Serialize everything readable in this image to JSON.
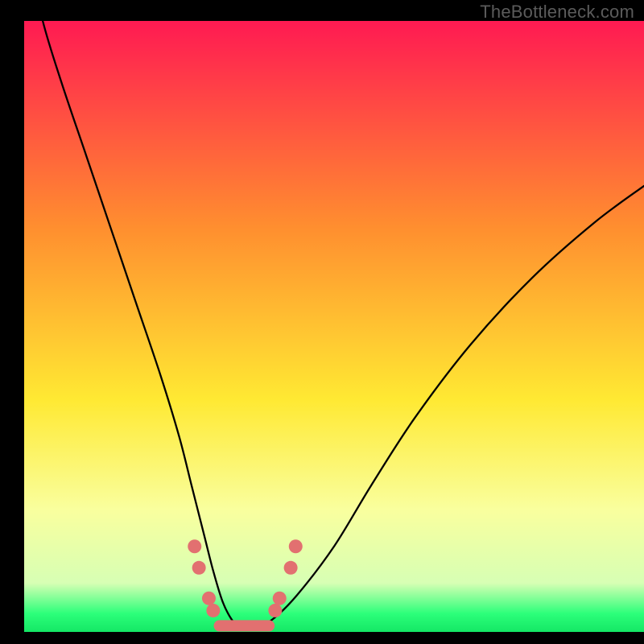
{
  "attribution": "TheBottleneck.com",
  "colors": {
    "frame": "#000000",
    "gradient_top": "#ff1a52",
    "gradient_mid_upper": "#ff8f2f",
    "gradient_mid": "#ffe933",
    "gradient_lower": "#f9ff9e",
    "gradient_green": "#2cff7a",
    "curve": "#000000",
    "marker": "#e27070"
  },
  "chart_data": {
    "type": "line",
    "title": "",
    "xlabel": "",
    "ylabel": "",
    "xlim": [
      0,
      100
    ],
    "ylim": [
      0,
      100
    ],
    "grid": false,
    "legend": false,
    "annotations": [],
    "series": [
      {
        "name": "bottleneck-curve",
        "x": [
          3,
          6,
          10,
          14,
          18,
          22,
          25,
          27,
          29,
          30.5,
          32,
          33.5,
          35,
          37,
          40,
          44,
          50,
          56,
          63,
          72,
          82,
          92,
          100
        ],
        "y": [
          100,
          90,
          78,
          66,
          54,
          42,
          32,
          24,
          16,
          10,
          5,
          2,
          0.5,
          0.5,
          2,
          6,
          14,
          24,
          35,
          47,
          58,
          67,
          73
        ]
      }
    ],
    "markers": {
      "name": "curve-dots",
      "points": [
        {
          "x": 27.5,
          "y": 14
        },
        {
          "x": 28.2,
          "y": 10.5
        },
        {
          "x": 29.8,
          "y": 5.5
        },
        {
          "x": 30.5,
          "y": 3.5
        },
        {
          "x": 40.5,
          "y": 3.5
        },
        {
          "x": 41.2,
          "y": 5.5
        },
        {
          "x": 43.0,
          "y": 10.5
        },
        {
          "x": 43.8,
          "y": 14
        }
      ],
      "flat_segment": {
        "x0": 31.5,
        "y": 1.0,
        "x1": 39.5
      }
    },
    "background_gradient_stops": [
      {
        "offset": 0,
        "color": "#ff1a52"
      },
      {
        "offset": 34,
        "color": "#ff8f2f"
      },
      {
        "offset": 62,
        "color": "#ffe933"
      },
      {
        "offset": 80,
        "color": "#f9ff9e"
      },
      {
        "offset": 92,
        "color": "#d7ffb4"
      },
      {
        "offset": 97,
        "color": "#2cff7a"
      },
      {
        "offset": 100,
        "color": "#14e765"
      }
    ]
  }
}
